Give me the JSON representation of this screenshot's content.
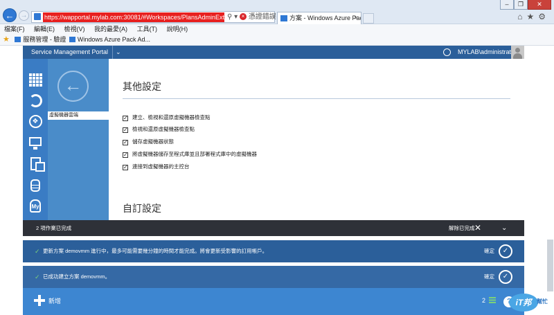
{
  "browser": {
    "url": "https://wapportal.mylab.com:30081/#Workspaces/PlansAdminExtension",
    "cert_error": "憑證錯誤",
    "tab_title": "方案 - Windows Azure Pac...",
    "tab_close": "×",
    "menu": [
      "檔案(F)",
      "編輯(E)",
      "檢視(V)",
      "我的最愛(A)",
      "工具(T)",
      "說明(H)"
    ],
    "favorites": [
      "服務管理 - 驗證",
      "Windows Azure Pack Ad..."
    ]
  },
  "portal": {
    "title": "Service Management Portal",
    "user": "MYLAB\\administrator",
    "subnav_selected": "虛擬機器雲端"
  },
  "content": {
    "section_title": "其他設定",
    "options": [
      {
        "label": "建立、檢視和還原虛擬機器檢查點",
        "checked": true
      },
      {
        "label": "檢視和還原虛擬機器檢查點",
        "checked": true
      },
      {
        "label": "儲存虛擬機器狀態",
        "checked": true
      },
      {
        "label": "將虛擬機器儲存至程式庫並且部署程式庫中的虛擬機器",
        "checked": true
      },
      {
        "label": "連接到虛擬機器的主控台",
        "checked": true
      }
    ],
    "section_title2": "自訂設定"
  },
  "notifications": {
    "summary": "2 項作業已完成",
    "clear_label": "解除已完成",
    "items": [
      {
        "text": "更新方案 demovmm 進行中，最多可能需要幾分鐘的時間才能完成。將會更新受影響的訂用帳戶。",
        "ok_label": "確定"
      },
      {
        "text": "已成功建立方案 demovmm。",
        "ok_label": "確定"
      }
    ]
  },
  "command_bar": {
    "new_label": "新增",
    "count": "2",
    "help": "?"
  },
  "colors": {
    "header": "#2b5f9a",
    "leftnav": "#3a7cc4",
    "subnav": "#4a8cc9",
    "notification_dark": "#2e3138",
    "command_bar": "#3d86d1"
  },
  "icons": [
    "all-items-icon",
    "sync-icon",
    "network-icon",
    "vm-monitor-icon",
    "plans-icon",
    "database-icon",
    "my-sql-icon",
    "back-arrow-icon",
    "globe-icon",
    "avatar-icon",
    "plus-icon",
    "help-icon"
  ]
}
